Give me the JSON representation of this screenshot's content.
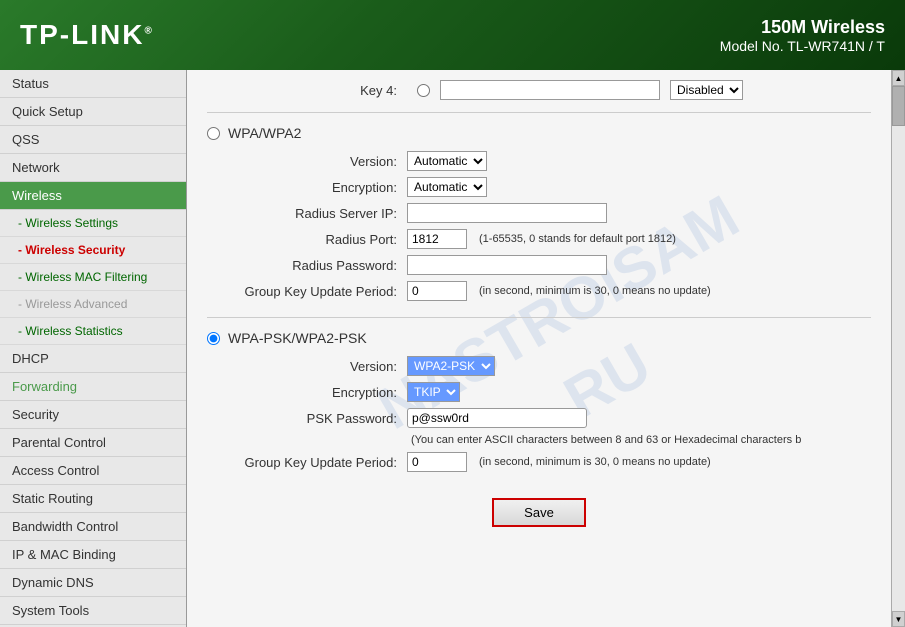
{
  "header": {
    "logo": "TP-LINK",
    "tm": "®",
    "product_title": "150M Wireless",
    "model": "Model No. TL-WR741N / T"
  },
  "sidebar": {
    "items": [
      {
        "id": "status",
        "label": "Status",
        "type": "top"
      },
      {
        "id": "quick-setup",
        "label": "Quick Setup",
        "type": "top"
      },
      {
        "id": "qss",
        "label": "QSS",
        "type": "top"
      },
      {
        "id": "network",
        "label": "Network",
        "type": "top"
      },
      {
        "id": "wireless",
        "label": "Wireless",
        "type": "active"
      },
      {
        "id": "wireless-settings",
        "label": "- Wireless Settings",
        "type": "sub"
      },
      {
        "id": "wireless-security",
        "label": "- Wireless Security",
        "type": "sub selected"
      },
      {
        "id": "wireless-mac-filtering",
        "label": "- Wireless MAC Filtering",
        "type": "sub"
      },
      {
        "id": "wireless-advanced",
        "label": "- Wireless Advanced",
        "type": "sub"
      },
      {
        "id": "wireless-statistics",
        "label": "- Wireless Statistics",
        "type": "sub"
      },
      {
        "id": "dhcp",
        "label": "DHCP",
        "type": "top"
      },
      {
        "id": "forwarding",
        "label": "Forwarding",
        "type": "top-green"
      },
      {
        "id": "security",
        "label": "Security",
        "type": "top"
      },
      {
        "id": "parental-control",
        "label": "Parental Control",
        "type": "top"
      },
      {
        "id": "access-control",
        "label": "Access Control",
        "type": "top"
      },
      {
        "id": "static-routing",
        "label": "Static Routing",
        "type": "top"
      },
      {
        "id": "bandwidth-control",
        "label": "Bandwidth Control",
        "type": "top"
      },
      {
        "id": "ip-mac-binding",
        "label": "IP & MAC Binding",
        "type": "top"
      },
      {
        "id": "dynamic-dns",
        "label": "Dynamic DNS",
        "type": "top"
      },
      {
        "id": "system-tools",
        "label": "System Tools",
        "type": "top"
      }
    ]
  },
  "content": {
    "watermark_line1": "NASTROISAM",
    "watermark_line2": ".RU",
    "key4": {
      "label": "Key 4:",
      "disabled_option": "Disabled"
    },
    "wpa_wpa2": {
      "radio_label": "WPA/WPA2",
      "version_label": "Version:",
      "version_value": "Automatic",
      "encryption_label": "Encryption:",
      "encryption_value": "Automatic",
      "radius_ip_label": "Radius Server IP:",
      "radius_ip_value": "",
      "radius_port_label": "Radius Port:",
      "radius_port_value": "1812",
      "radius_port_note": "(1-65535, 0 stands for default port 1812)",
      "radius_password_label": "Radius Password:",
      "radius_password_value": "",
      "group_key_label": "Group Key Update Period:",
      "group_key_value": "0",
      "group_key_note": "(in second, minimum is 30, 0 means no update)"
    },
    "wpa_psk": {
      "radio_label": "WPA-PSK/WPA2-PSK",
      "version_label": "Version:",
      "version_value": "WPA2-PSK",
      "encryption_label": "Encryption:",
      "encryption_value": "TKIP",
      "psk_password_label": "PSK Password:",
      "psk_password_value": "p@ssw0rd",
      "psk_note": "(You can enter ASCII characters between 8 and 63 or Hexadecimal characters b",
      "group_key_label": "Group Key Update Period:",
      "group_key_value": "0",
      "group_key_note": "(in second, minimum is 30, 0 means no update)"
    },
    "save_button": "Save"
  }
}
